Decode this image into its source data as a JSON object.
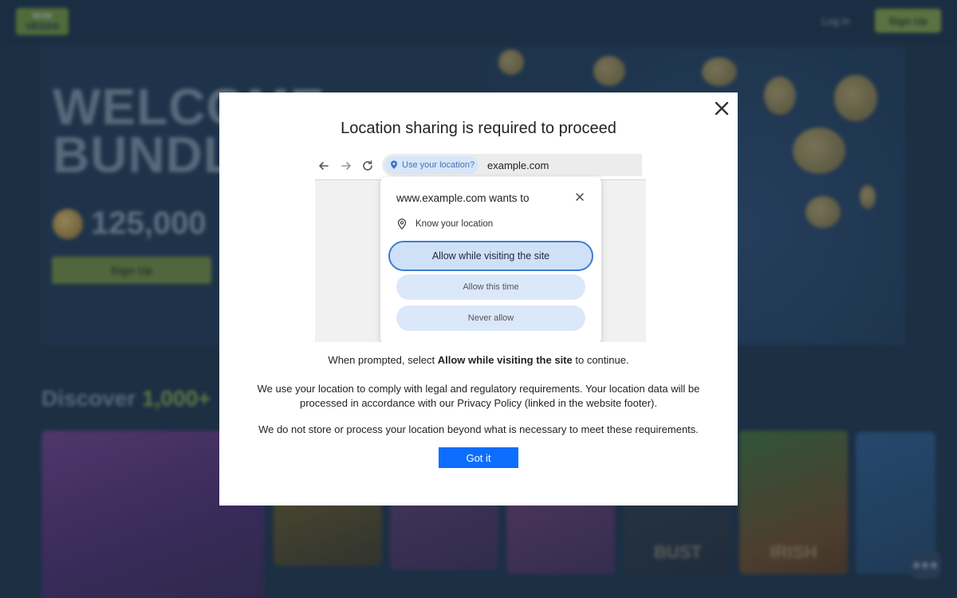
{
  "background": {
    "logo": {
      "line1": "WOW",
      "line2": "VEGAS"
    },
    "header": {
      "login_label": "Log in",
      "signup_label": "Sign Up"
    },
    "hero": {
      "headline_line1": "WELCOME",
      "headline_line2": "BUNDLE",
      "bonus_amount": "125,000",
      "signup_label": "Sign Up"
    },
    "discover": {
      "prefix": "Discover ",
      "highlight": "1,000+"
    },
    "tiles": [
      {
        "label": ""
      },
      {
        "label": ""
      },
      {
        "label": ""
      },
      {
        "label": ""
      },
      {
        "label": "BUST"
      },
      {
        "label": "IRISH"
      },
      {
        "label": ""
      }
    ]
  },
  "modal": {
    "title": "Location sharing is required to proceed",
    "close_icon": "close-icon",
    "illustration": {
      "chip_label": "Use your location?",
      "url": "example.com",
      "popup_title": "www.example.com wants to",
      "know_location": "Know your location",
      "allow_visit": "Allow while visiting the site",
      "allow_once": "Allow this time",
      "never_allow": "Never allow"
    },
    "prompt_prefix": "When prompted, select ",
    "prompt_bold": "Allow while visiting the site",
    "prompt_suffix": " to continue.",
    "paragraph": "We use your location to comply with legal and regulatory requirements. Your location data will be processed in accordance with our Privacy Policy (linked in the website footer).",
    "storage_note": "We do not store or process your location beyond what is necessary to meet these requirements.",
    "button_label": "Got it"
  },
  "colors": {
    "primary_button": "#0d6efd",
    "overlay_bg": "#1f3449",
    "accent_green": "#7f9a45"
  }
}
